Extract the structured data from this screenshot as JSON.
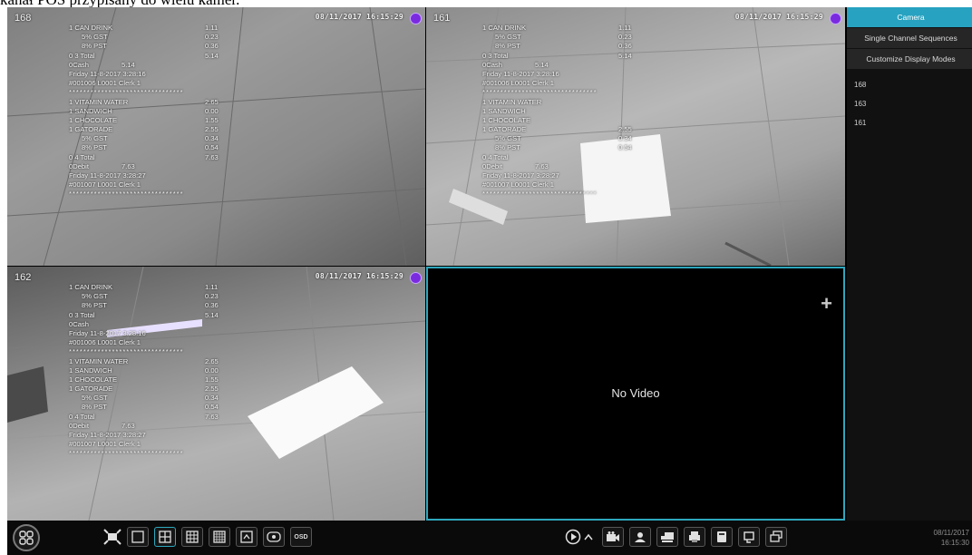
{
  "page": {
    "caption": "kanał POS przypisany do wielu kamer."
  },
  "cameras": [
    {
      "id": "168",
      "time": "08/11/2017 16:15:29",
      "receipt": [
        {
          "desc": "1 CAN DRINK",
          "val": "1.11",
          "type": ""
        },
        {
          "desc": "5% GST",
          "val": "0.23",
          "type": "ind"
        },
        {
          "desc": "8% PST",
          "val": "0.36",
          "type": "ind"
        },
        {
          "desc": "0  3 Total",
          "val": "5.14",
          "type": ""
        },
        {
          "desc": "0Cash",
          "val": "5.14",
          "type": "pay"
        },
        {
          "desc": "Friday   11-8-2017  3:28:16",
          "val": "",
          "type": ""
        },
        {
          "desc": "#001006 L0001 Clerk 1",
          "val": "",
          "type": ""
        },
        {
          "desc": "********************************",
          "val": "",
          "type": "sep"
        },
        {
          "desc": "1 VITAMIN WATER",
          "val": "2.65",
          "type": ""
        },
        {
          "desc": "1 SANDWICH",
          "val": "0.00",
          "type": ""
        },
        {
          "desc": "1 CHOCOLATE",
          "val": "1.55",
          "type": ""
        },
        {
          "desc": "1 GATORADE",
          "val": "2.55",
          "type": ""
        },
        {
          "desc": "5% GST",
          "val": "0.34",
          "type": "ind"
        },
        {
          "desc": "8% PST",
          "val": "0.54",
          "type": "ind"
        },
        {
          "desc": "0  4 Total",
          "val": "7.63",
          "type": ""
        },
        {
          "desc": "0Debit",
          "val": "7.63",
          "type": "pay"
        },
        {
          "desc": "Friday   11-8-2017  3:28:27",
          "val": "",
          "type": ""
        },
        {
          "desc": "#001007 L0001 Clerk 1",
          "val": "",
          "type": ""
        },
        {
          "desc": "********************************",
          "val": "",
          "type": "sep"
        }
      ]
    },
    {
      "id": "161",
      "time": "08/11/2017 16:15:29",
      "receipt": [
        {
          "desc": "1 CAN DRINK",
          "val": "1.11",
          "type": ""
        },
        {
          "desc": "5% GST",
          "val": "0.23",
          "type": "ind"
        },
        {
          "desc": "8% PST",
          "val": "0.36",
          "type": "ind"
        },
        {
          "desc": "0  3 Total",
          "val": "5.14",
          "type": ""
        },
        {
          "desc": "0Cash",
          "val": "5.14",
          "type": "pay"
        },
        {
          "desc": "Friday   11-8-2017  3:28:16",
          "val": "",
          "type": ""
        },
        {
          "desc": "#001006 L0001 Clerk 1",
          "val": "",
          "type": ""
        },
        {
          "desc": "********************************",
          "val": "",
          "type": "sep"
        },
        {
          "desc": "1 VITAMIN WATER",
          "val": "",
          "type": ""
        },
        {
          "desc": "1 SANDWICH",
          "val": "",
          "type": ""
        },
        {
          "desc": "1 CHOCOLATE",
          "val": "",
          "type": ""
        },
        {
          "desc": "1 GATORADE",
          "val": "2.55",
          "type": ""
        },
        {
          "desc": "5% GST",
          "val": "0.34",
          "type": "ind"
        },
        {
          "desc": "8% PST",
          "val": "0.54",
          "type": "ind"
        },
        {
          "desc": "0  4 Total",
          "val": "",
          "type": ""
        },
        {
          "desc": "0Debit",
          "val": "7.63",
          "type": "pay"
        },
        {
          "desc": "Friday   11-8-2017  3:28:27",
          "val": "",
          "type": ""
        },
        {
          "desc": "#001007 L0001 Clerk 1",
          "val": "",
          "type": ""
        },
        {
          "desc": "********************************",
          "val": "",
          "type": "sep"
        }
      ]
    },
    {
      "id": "162",
      "time": "08/11/2017 16:15:29",
      "receipt": [
        {
          "desc": "1 CAN DRINK",
          "val": "1.11",
          "type": ""
        },
        {
          "desc": "5% GST",
          "val": "0.23",
          "type": "ind"
        },
        {
          "desc": "8% PST",
          "val": "0.36",
          "type": "ind"
        },
        {
          "desc": "0  3 Total",
          "val": "5.14",
          "type": ""
        },
        {
          "desc": "0Cash",
          "val": "",
          "type": "pay"
        },
        {
          "desc": "Friday   11-8-2017  3:28:16",
          "val": "",
          "type": ""
        },
        {
          "desc": "#001006 L0001 Clerk 1",
          "val": "",
          "type": ""
        },
        {
          "desc": "********************************",
          "val": "",
          "type": "sep"
        },
        {
          "desc": "1 VITAMIN WATER",
          "val": "2.65",
          "type": ""
        },
        {
          "desc": "1 SANDWICH",
          "val": "0.00",
          "type": ""
        },
        {
          "desc": "1 CHOCOLATE",
          "val": "1.55",
          "type": ""
        },
        {
          "desc": "1 GATORADE",
          "val": "2.55",
          "type": ""
        },
        {
          "desc": "5% GST",
          "val": "0.34",
          "type": "ind"
        },
        {
          "desc": "8% PST",
          "val": "0.54",
          "type": "ind"
        },
        {
          "desc": "0  4 Total",
          "val": "7.63",
          "type": ""
        },
        {
          "desc": "0Debit",
          "val": "7.63",
          "type": "pay"
        },
        {
          "desc": "Friday   11-8-2017  3:28:27",
          "val": "",
          "type": ""
        },
        {
          "desc": "#001007 L0001 Clerk 1",
          "val": "",
          "type": ""
        },
        {
          "desc": "********************************",
          "val": "",
          "type": "sep"
        }
      ]
    }
  ],
  "empty_view": {
    "message": "No Video",
    "add_icon": "plus-icon",
    "add_symbol": "+"
  },
  "sidebar": {
    "tabs": [
      {
        "label": "Camera",
        "active": true
      },
      {
        "label": "Single Channel Sequences",
        "active": false
      },
      {
        "label": "Customize Display Modes",
        "active": false
      }
    ],
    "camera_list": [
      "168",
      "163",
      "161"
    ]
  },
  "toolbar": {
    "osd_label": "OSD",
    "date": "08/11/2017",
    "time": "16:15:30"
  },
  "colors": {
    "accent": "#2ea8be",
    "active_tab": "#27a2c0",
    "record_dot": "#7a2be0"
  }
}
